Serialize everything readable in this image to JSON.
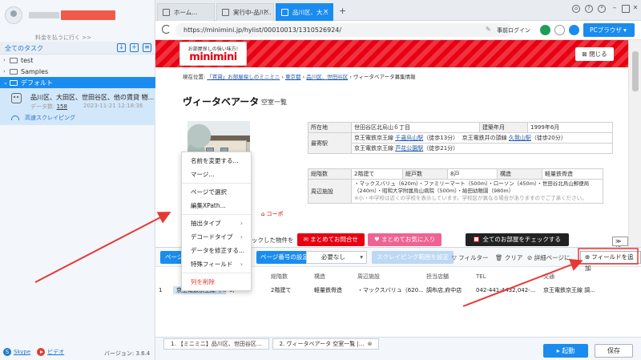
{
  "sidebar": {
    "pay_link": "料金を払うに行く >>",
    "tasks_title": "全てのタスク",
    "folders": [
      {
        "label": "test"
      },
      {
        "label": "Samples"
      },
      {
        "label": "デフォルト"
      }
    ],
    "task": {
      "title": "品川区、大田区、世田谷区、他の賃貸  物...",
      "count_label": "データ数:",
      "count": "158",
      "date": "2023-11-21 12:18:36",
      "speed_label": "高速スクレイピング"
    },
    "footer": {
      "skype": "Skype",
      "video": "ビデオ",
      "version": "バージョン: 3.6.4"
    }
  },
  "browser": {
    "tabs": [
      {
        "label": "ホーム..."
      },
      {
        "label": "実行中-品川..."
      },
      {
        "label": "品川区、大..."
      }
    ],
    "url": "https://minimini.jp/hylist/00010013/1310526924/",
    "pre_login": "事前ログイン",
    "pc_browser": "PCブラウザ"
  },
  "webpage": {
    "logo_small": "お部屋探しの強い味方!",
    "logo_main": "minimini",
    "close": "閉じる",
    "breadcrumb": {
      "prefix": "現在位置:",
      "links": [
        "「賃貸」お部屋探しのミニミニ",
        "東京都",
        "品川区、世田谷区"
      ],
      "current": "ヴィータベアータ募集情報"
    },
    "title": "ヴィータベアータ",
    "subtitle": "空室一覧",
    "kopo": "コーポ",
    "props": {
      "location_label": "所在地",
      "location": "世田谷区北烏山６丁目",
      "built_label": "建築年月",
      "built": "1999年6月",
      "station_label": "最寄駅",
      "station_line1": "京王電鉄京王線",
      "station1": "千歳烏山駅",
      "station1_walk": "（徒歩13分）",
      "station_line2": "京王電鉄井の頭線",
      "station2": "久我山駅",
      "station2_walk": "（徒歩20分）",
      "station_line3": "京王電鉄京王線",
      "station3": "芦花公園駅",
      "station3_walk": "（徒歩21分）",
      "floors_label": "総階数",
      "floors": "2階建て",
      "units_label": "総戸数",
      "units": "8戸",
      "structure_label": "構造",
      "structure": "軽量鉄骨造",
      "nearby_label": "周辺施設",
      "nearby1": "・マックスバリュ（620m）・ファミリーマート（500m）・ローソン（450m）・世田谷北烏山郵便局",
      "nearby2": "（240m）・昭和大学附属烏山病院（500m）・給田幼稚園（980m）",
      "nearby_note": "※小・中学校は近くの学校を表示しています。学校区が異なる場合がありますのでご了承ください。"
    },
    "actions": {
      "check_label": "ックした物件を",
      "inquiry": "まとめてお問合せ",
      "favorite": "まとめてお気に入り",
      "check_all": "全てのお部屋をチェックする",
      "fold": "折る"
    }
  },
  "context_menu": {
    "items": [
      "名前を変更する...",
      "マージ...",
      "ページで選択",
      "編集XPath...",
      "抽出タイプ",
      "デコードタイプ",
      "データを修正する...",
      "特殊フィールド",
      "列を削除"
    ]
  },
  "data_panel": {
    "tab_label": "ページ",
    "page_setting": "ページ番号の設定",
    "page_select": "必要なし",
    "scrape_range": "スクレイピング範囲を設定",
    "filter": "フィルター",
    "clear": "クリア",
    "detail": "詳細ページに",
    "add_field": "フィールドを追加",
    "columns": [
      "",
      "",
      "",
      "総階数",
      "構造",
      "周辺施設",
      "担当店舗",
      "TEL",
      "交通"
    ],
    "rows": [
      [
        "1",
        "京王電鉄京王線  千...",
        "8戸",
        "2階建て",
        "軽量鉄骨造",
        "・マックスバリュ（620...",
        "調布店,府中店",
        "042-441-4432,042-...",
        "京王電鉄京王線  調..."
      ]
    ]
  },
  "bottom": {
    "page_tabs": [
      "1. 【ミニミニ】品川区、世田谷区...",
      "2. ヴィータベアータ  空室一覧 |..."
    ],
    "start": "起動",
    "save": "保存"
  },
  "colors": {
    "accent": "#1a8cf0",
    "brand_red": "#e60012",
    "annotation_red": "#e53935"
  }
}
